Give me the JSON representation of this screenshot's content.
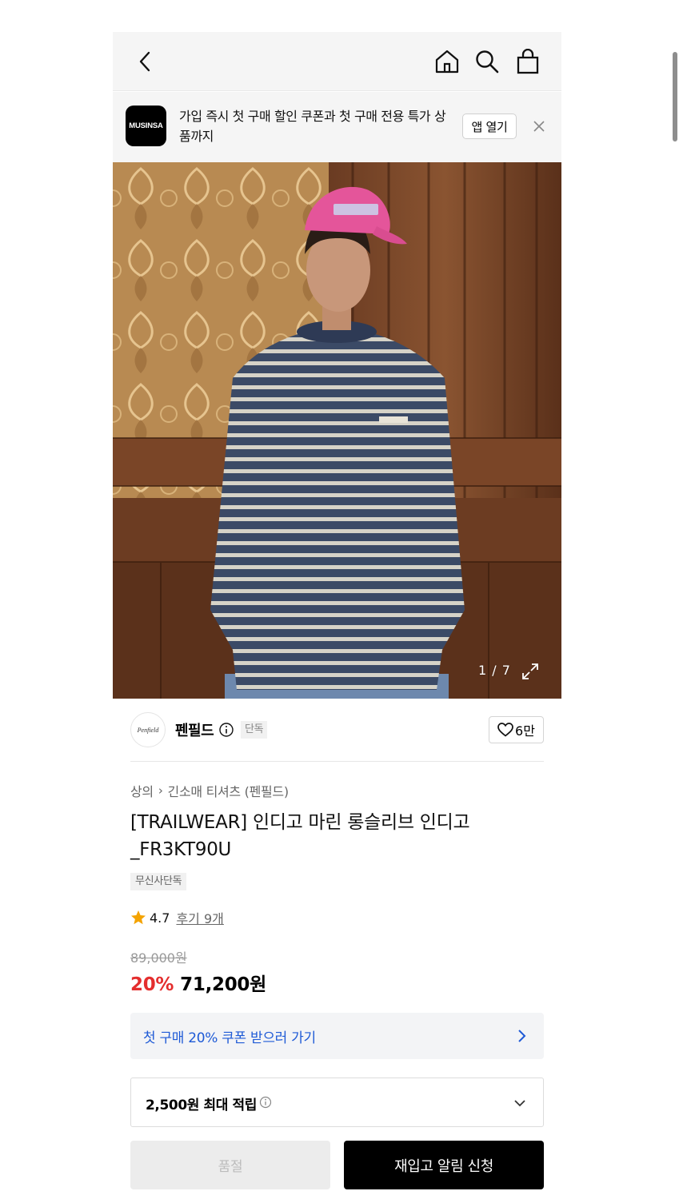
{
  "header": {
    "back_icon": "chevron-left-icon",
    "home_icon": "home-icon",
    "search_icon": "search-icon",
    "bag_icon": "shopping-bag-icon"
  },
  "app_banner": {
    "logo_text": "MUSINSA",
    "message": "가입 즉시 첫 구매 할인 쿠폰과 첫 구매 전용 특가 상품까지",
    "open_label": "앱 열기",
    "close_icon": "close-icon"
  },
  "gallery": {
    "counter": "1 / 7",
    "expand_icon": "expand-icon"
  },
  "brand": {
    "logo_text": "Penfield",
    "name": "펜필드",
    "tag": "단독",
    "likes": "6만"
  },
  "product": {
    "breadcrumb": [
      "상의",
      "긴소매 티셔츠 (펜필드)"
    ],
    "title": "[TRAILWEAR] 인디고 마린 롱슬리브 인디고_FR3KT90U",
    "badge": "무신사단독",
    "rating": "4.7",
    "reviews": "후기 9개",
    "original_price": "89,000원",
    "discount": "20%",
    "sale_price": "71,200원"
  },
  "coupon": {
    "text": "첫 구매 20% 쿠폰 받으러 가기"
  },
  "points": {
    "text": "2,500원 최대 적립"
  },
  "actions": {
    "soldout_label": "품절",
    "restock_label": "재입고 알림 신청"
  },
  "colors": {
    "accent_blue": "#1e5ad6",
    "discount_red": "#e42e2e",
    "star": "#f4a300"
  }
}
